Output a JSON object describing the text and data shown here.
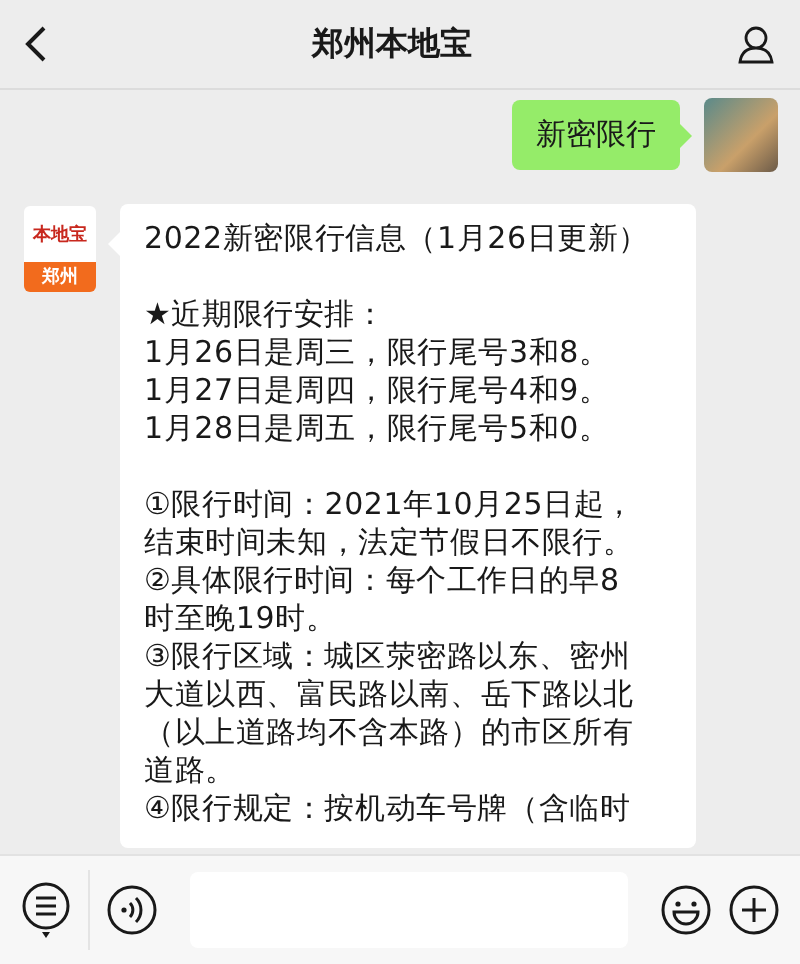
{
  "header": {
    "title": "郑州本地宝"
  },
  "messages": [
    {
      "kind": "sent",
      "text": "新密限行"
    },
    {
      "kind": "received",
      "logo": {
        "name": "本地宝",
        "city": "郑州"
      },
      "paragraphs": [
        [
          "2022新密限行信息（1月26日更新）"
        ],
        [
          "★近期限行安排：",
          "1月26日是周三，限行尾号3和8。",
          "1月27日是周四，限行尾号4和9。",
          "1月28日是周五，限行尾号5和0。"
        ],
        [
          "①限行时间：2021年10月25日起，",
          "结束时间未知，法定节假日不限行。",
          "②具体限行时间：每个工作日的早8",
          "时至晚19时。",
          "③限行区域：城区荥密路以东、密州",
          "大道以西、富民路以南、岳下路以北",
          "（以上道路均不含本路）的市区所有",
          "道路。",
          "④限行规定：按机动车号牌（含临时"
        ]
      ]
    }
  ]
}
